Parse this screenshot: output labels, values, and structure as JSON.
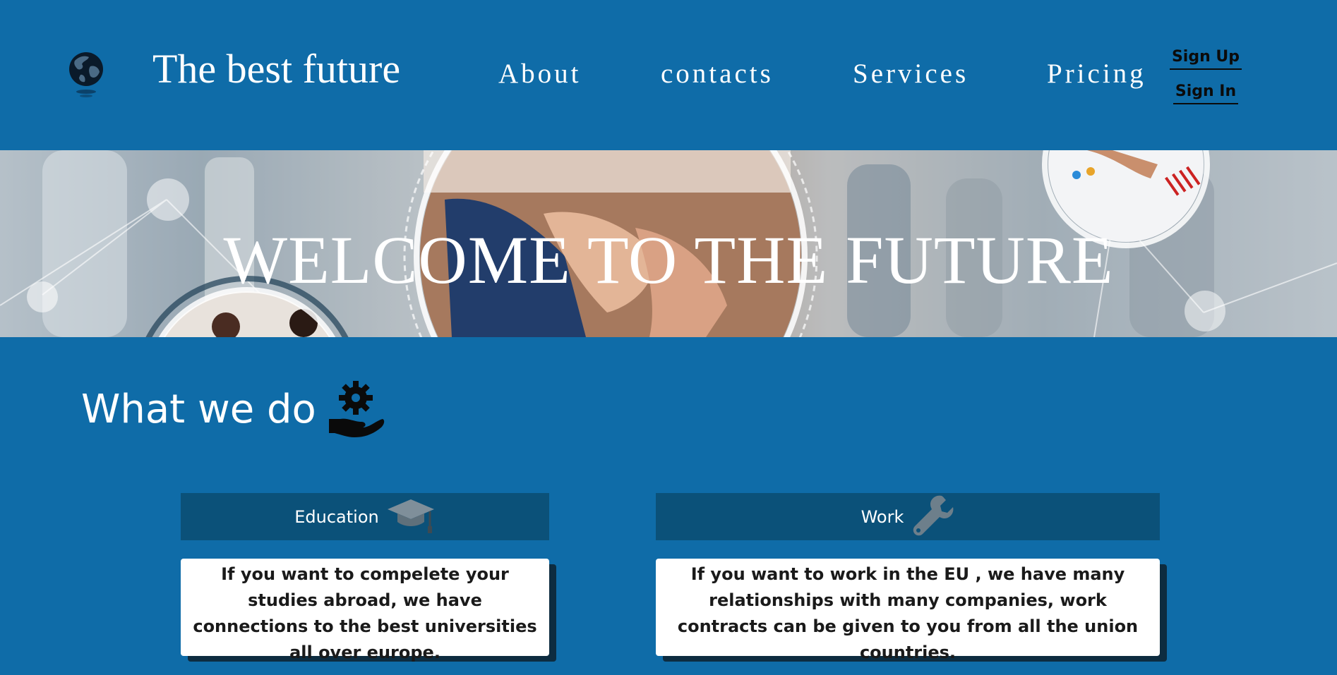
{
  "header": {
    "title": "The best future",
    "logo_icon": "globe-icon",
    "nav": [
      "About",
      "contacts",
      "Services",
      "Pricing"
    ],
    "sign_up": "Sign Up",
    "sign_in": "Sign In"
  },
  "hero": {
    "title": "WELCOME TO THE FUTURE",
    "image": "handshake-network-photo"
  },
  "section": {
    "title": "What we do",
    "icon": "gear-in-hand-icon"
  },
  "cards": [
    {
      "label": "Education",
      "icon": "graduation-cap-icon",
      "text": "If you want to compelete your studies abroad, we have connections to the best universities all over europe."
    },
    {
      "label": "Work",
      "icon": "wrench-icon",
      "text": "If you want to work in the EU , we have many relationships with many companies, work contracts can be given to you from all the union countries."
    }
  ],
  "colors": {
    "background": "#0f6ca8",
    "card_header": "#0b5179",
    "card_body": "#ffffff",
    "card_shadow": "#0d2c40"
  }
}
